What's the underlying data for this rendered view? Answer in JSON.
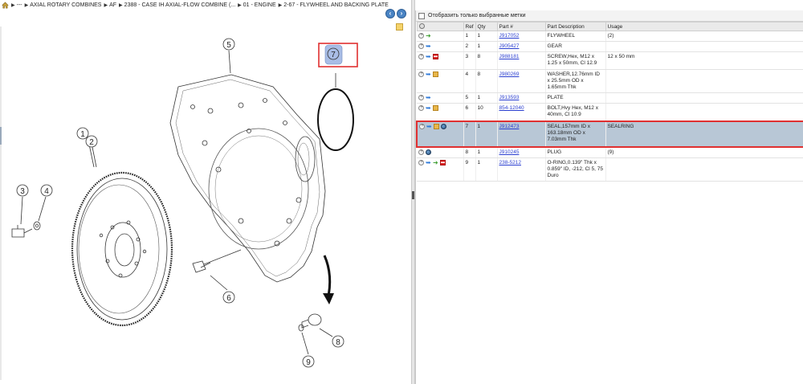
{
  "breadcrumb": {
    "home_icon": "home-icon",
    "items": [
      "---",
      "AXIAL ROTARY COMBINES",
      "AF",
      "2388 - CASE IH AXIAL-FLOW COMBINE (...",
      "01 - ENGINE",
      "2-67 - FLYWHEEL AND BACKING PLATE"
    ]
  },
  "drawing": {
    "nav_prev_icon": "arrow-left-icon",
    "nav_next_icon": "arrow-right-icon",
    "callouts": [
      "1",
      "2",
      "3",
      "4",
      "5",
      "6",
      "7",
      "8",
      "9"
    ],
    "selected_callout": "7"
  },
  "filter": {
    "label": "Отобразить только выбранные метки",
    "checked": false
  },
  "table": {
    "headers": [
      "",
      "Ref",
      "Qty",
      "Part #",
      "Part Description",
      "Usage"
    ],
    "rows": [
      {
        "icons": [
          "plus-icon",
          "arrow-green-icon"
        ],
        "ref": "1",
        "qty": "1",
        "part": "J917052",
        "desc": "FLYWHEEL",
        "usage": "(2)"
      },
      {
        "icons": [
          "plus-icon",
          "arrow-blue-icon"
        ],
        "ref": "2",
        "qty": "1",
        "part": "J905427",
        "desc": "GEAR",
        "usage": ""
      },
      {
        "icons": [
          "plus-icon",
          "arrow-blue-icon",
          "flag-icon"
        ],
        "ref": "3",
        "qty": "8",
        "part": "J988181",
        "desc": "SCREW,Hex, M12 x 1.25 x 50mm, Cl 12.9",
        "usage": "12 x 50 mm"
      },
      {
        "icons": [
          "plus-icon",
          "arrow-blue-icon",
          "cube-icon"
        ],
        "ref": "4",
        "qty": "8",
        "part": "J980269",
        "desc": "WASHER,12.76mm ID x 25.5mm OD x 1.65mm Thk",
        "usage": ""
      },
      {
        "icons": [
          "plus-icon",
          "arrow-blue-icon"
        ],
        "ref": "5",
        "qty": "1",
        "part": "J913593",
        "desc": "PLATE",
        "usage": ""
      },
      {
        "icons": [
          "plus-icon",
          "arrow-blue-icon",
          "cube-icon"
        ],
        "ref": "6",
        "qty": "10",
        "part": "854-12040",
        "desc": "BOLT,Hvy Hex, M12 x 40mm, Cl 10.9",
        "usage": ""
      },
      {
        "icons": [
          "plus-icon",
          "arrow-blue-icon",
          "cube-icon",
          "globe-icon"
        ],
        "ref": "7",
        "qty": "1",
        "part": "J912473",
        "desc": "SEAL,157mm ID x 163.18mm OD x 7.03mm Thk",
        "usage": "SEALRING",
        "selected": true
      },
      {
        "icons": [
          "plus-icon",
          "globe-icon"
        ],
        "ref": "8",
        "qty": "1",
        "part": "J910245",
        "desc": "PLUG",
        "usage": "(9)"
      },
      {
        "icons": [
          "plus-icon",
          "arrow-blue-icon",
          "arrow-green-icon",
          "flag-icon"
        ],
        "ref": "9",
        "qty": "1",
        "part": "238-5212",
        "desc": "O-RING,0.139\" Thk x 0.859\" ID, -212, Cl 5, 75 Duro",
        "usage": ""
      }
    ]
  },
  "colors": {
    "selection_row": "#b8c7d6",
    "highlight_border": "#e03030",
    "link": "#2b3fd0",
    "callout_highlight": "#a9bde6"
  }
}
